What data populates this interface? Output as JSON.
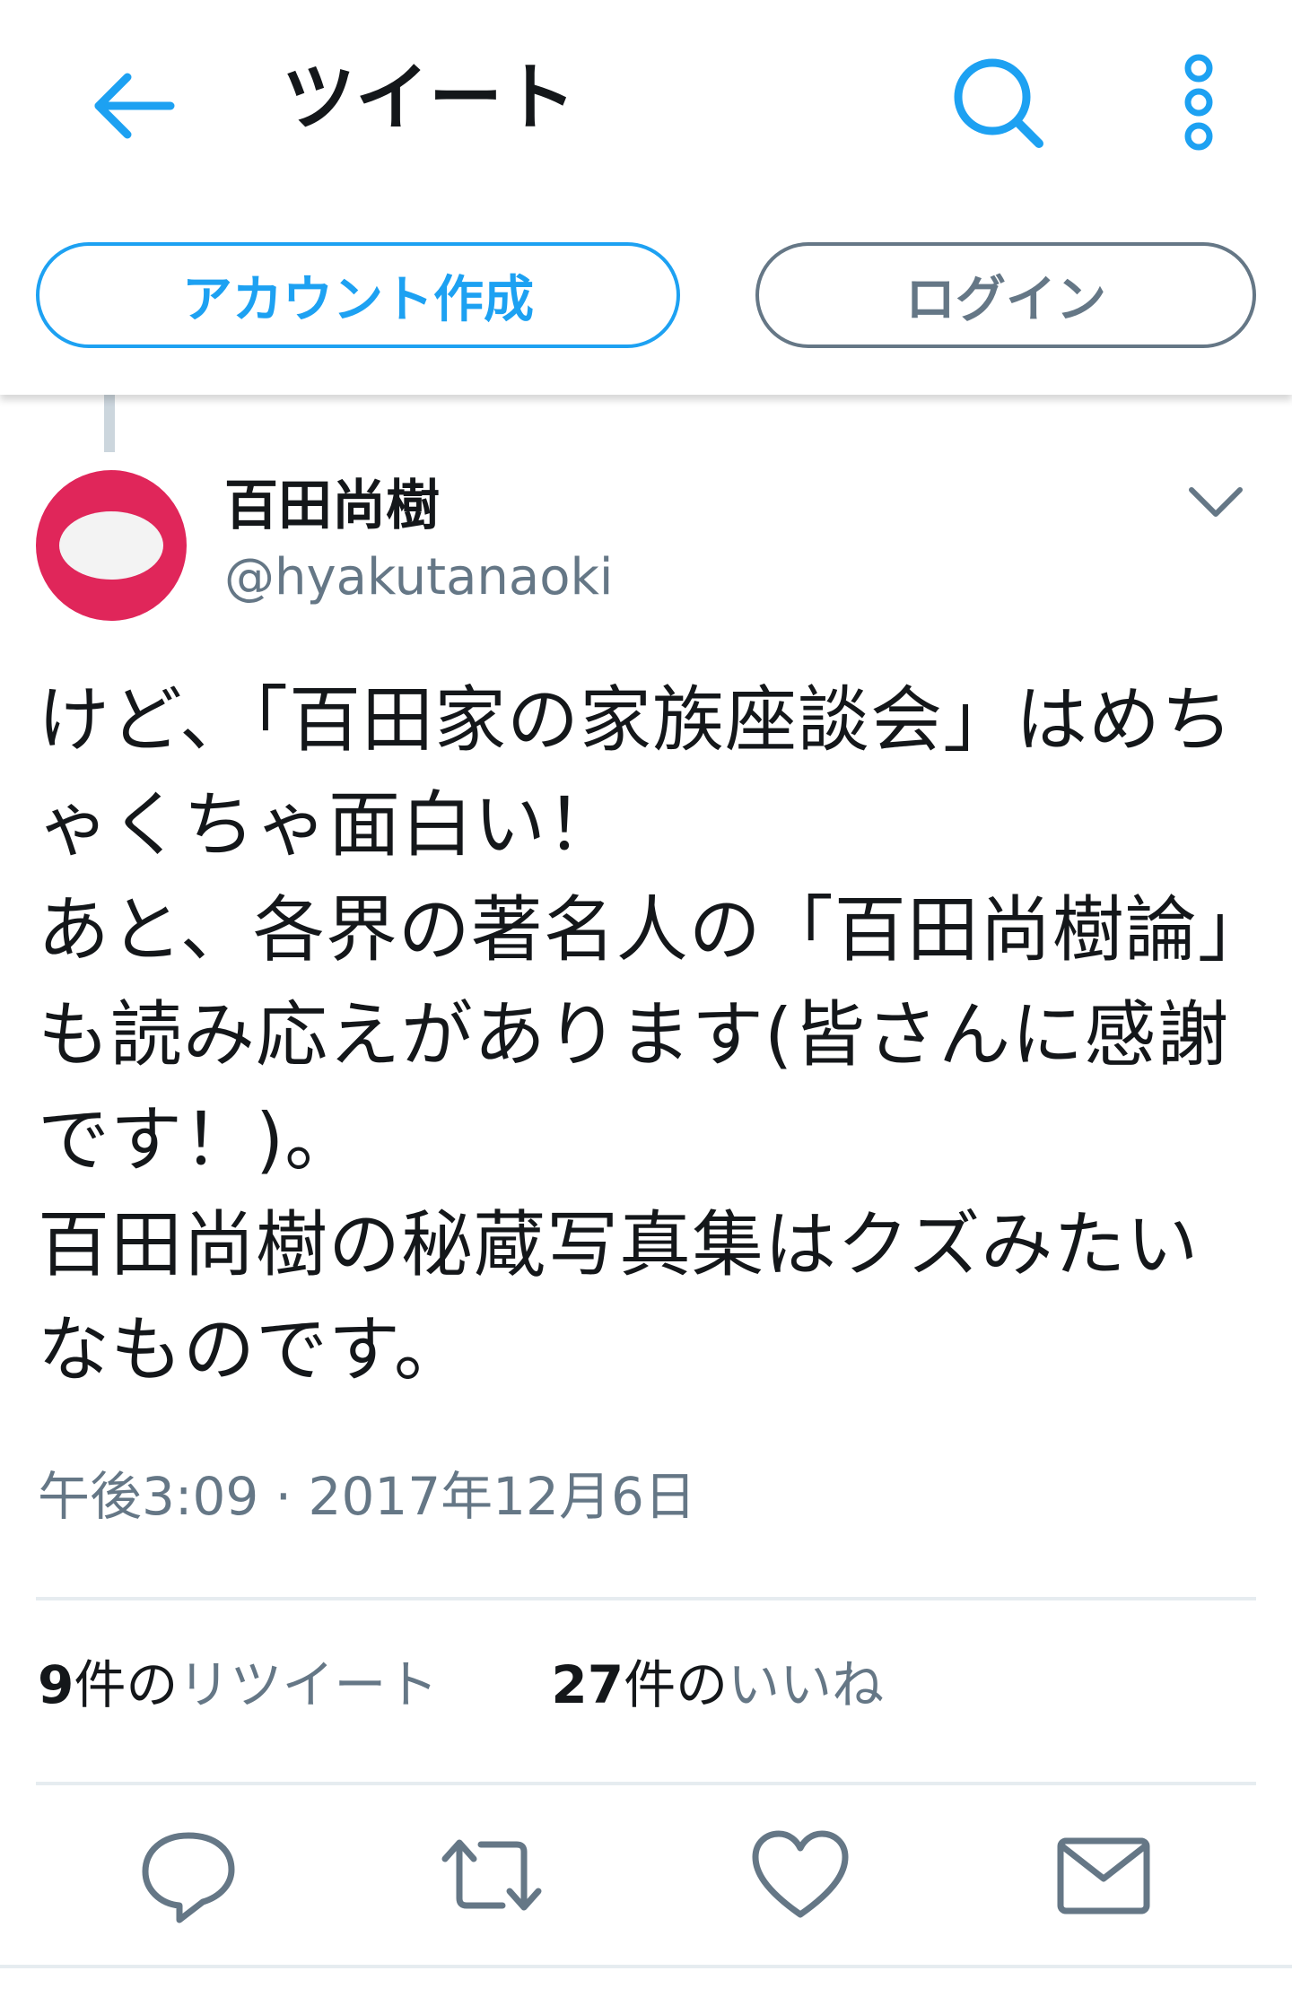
{
  "header": {
    "title": "ツイート",
    "back_icon": "arrow-left-icon",
    "search_icon": "search-icon",
    "more_icon": "vertical-dots-icon",
    "accent_color": "#1da1f2"
  },
  "auth": {
    "signup_label": "アカウント作成",
    "login_label": "ログイン"
  },
  "tweet": {
    "author": {
      "display_name": "百田尚樹",
      "handle": "@hyakutanaoki",
      "avatar_color": "#e0265a"
    },
    "text": "けど、「百田家の家族座談会」はめちゃくちゃ面白い！\nあと、各界の著名人の「百田尚樹論」も読み応えがあります(皆さんに感謝です！)。\n百田尚樹の秘蔵写真集はクズみたいなものです。",
    "timestamp": "午後3:09 · 2017年12月6日",
    "stats": {
      "retweet_count": "9",
      "retweet_count_suffix": "件の",
      "retweet_label": "リツイート",
      "like_count": "27",
      "like_count_suffix": "件の",
      "like_label": "いいね"
    }
  },
  "actions": {
    "reply_icon": "reply-icon",
    "retweet_icon": "retweet-icon",
    "like_icon": "heart-icon",
    "message_icon": "envelope-icon"
  }
}
